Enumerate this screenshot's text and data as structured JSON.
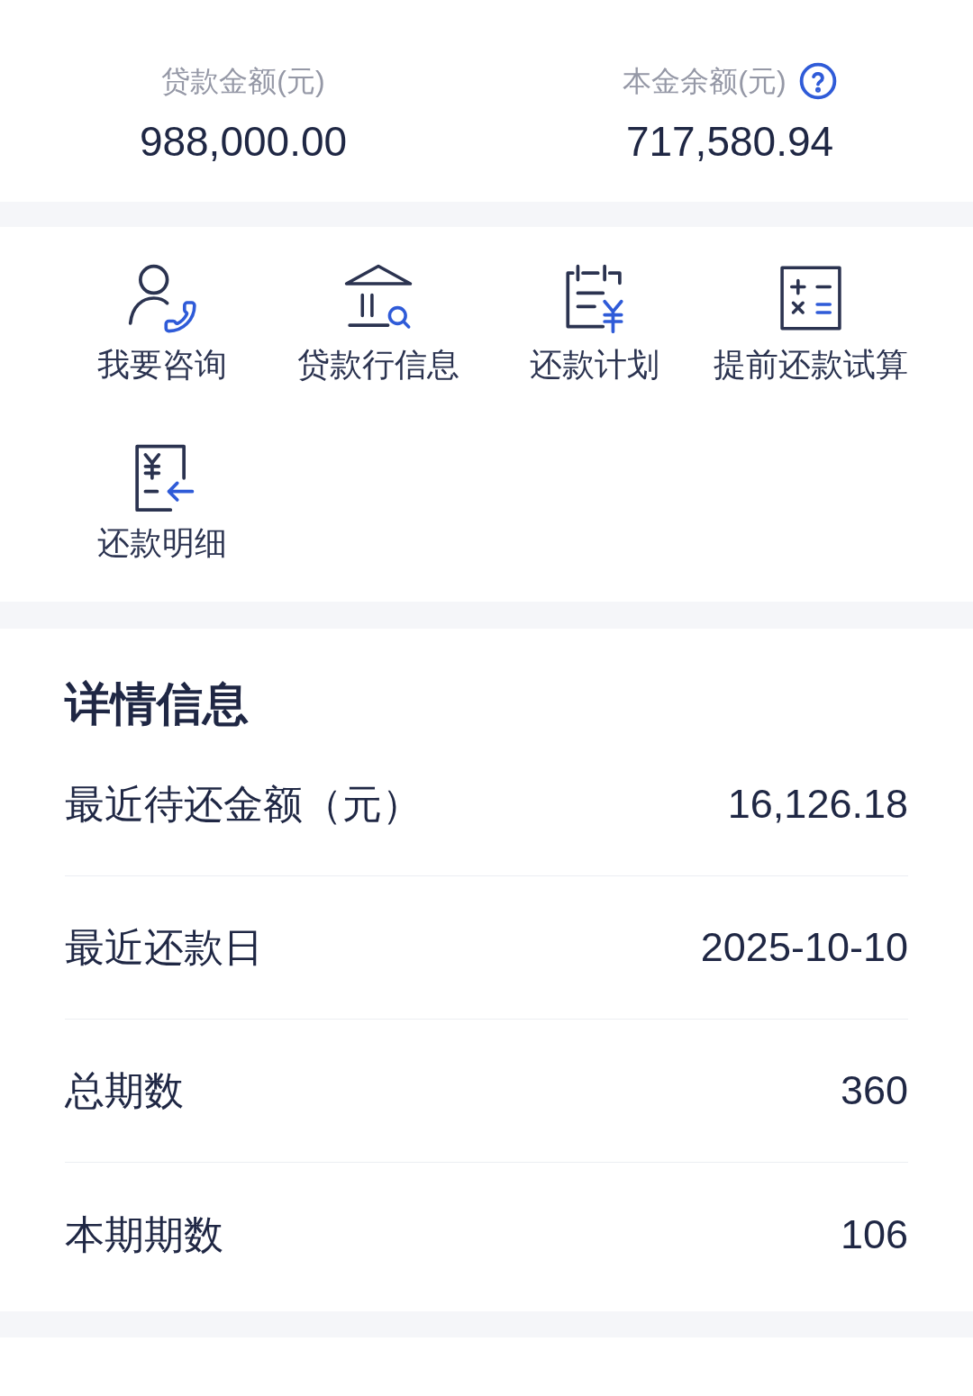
{
  "summary": [
    {
      "label": "贷款金额(元)",
      "value": "988,000.00",
      "help": false
    },
    {
      "label": "本金余额(元)",
      "value": "717,580.94",
      "help": true
    }
  ],
  "shortcuts": [
    {
      "label": "我要咨询",
      "kind": "consult"
    },
    {
      "label": "贷款行信息",
      "kind": "bank"
    },
    {
      "label": "还款计划",
      "kind": "plan"
    },
    {
      "label": "提前还款试算",
      "kind": "calculator"
    },
    {
      "label": "还款明细",
      "kind": "details"
    }
  ],
  "details": {
    "title": "详情信息",
    "rows": [
      {
        "label": "最近待还金额（元）",
        "value": "16,126.18"
      },
      {
        "label": "最近还款日",
        "value": "2025-10-10"
      },
      {
        "label": "总期数",
        "value": "360"
      },
      {
        "label": "本期期数",
        "value": "106"
      }
    ]
  }
}
